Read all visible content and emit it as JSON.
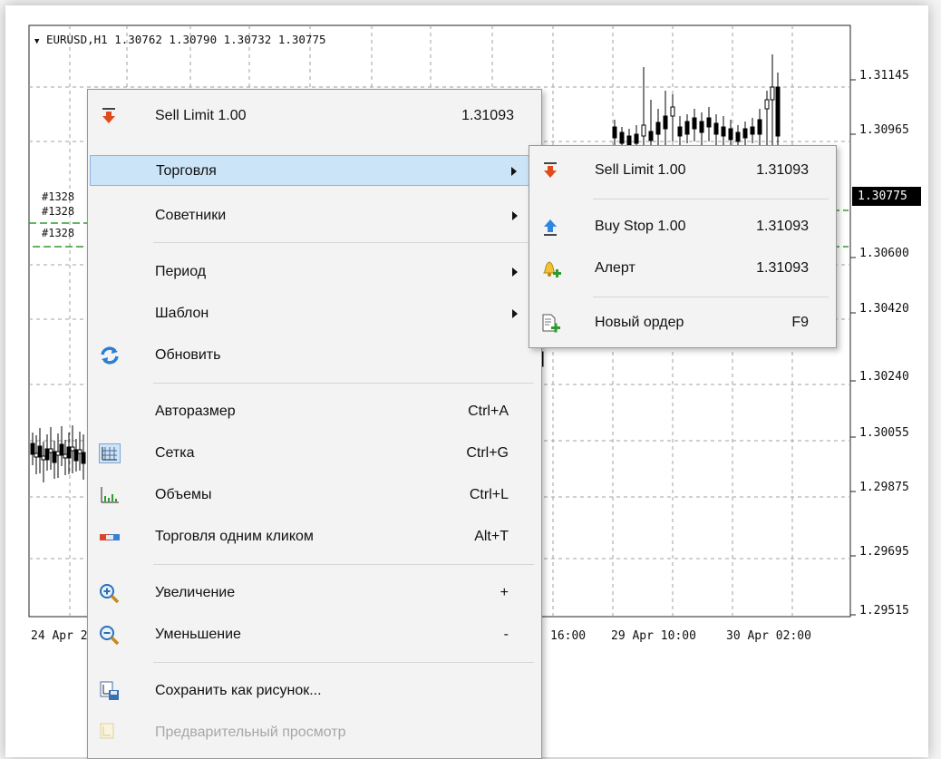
{
  "chart": {
    "ohlc_header": "EURUSD,H1  1.30762 1.30790 1.30732 1.30775",
    "current_price": "1.30775",
    "price_labels": [
      "1.31145",
      "1.30965",
      "1.30600",
      "1.30420",
      "1.30240",
      "1.30055",
      "1.29875",
      "1.29695",
      "1.29515"
    ],
    "time_labels": [
      "24 Apr 2",
      "16:00",
      "29 Apr 10:00",
      "30 Apr 02:00"
    ],
    "order_tags": [
      "#1328",
      "#1328",
      "#1328"
    ],
    "colors": {
      "grid": "#a0a0a0",
      "orders": "#2f9e2f",
      "candles": "#000000"
    }
  },
  "menu": {
    "items": [
      {
        "label": "Sell Limit 1.00",
        "value": "1.31093",
        "icon": "sell-arrow-icon"
      },
      {
        "label": "Торговля",
        "submenu": true,
        "highlight": true
      },
      {
        "label": "Советники",
        "submenu": true
      },
      {
        "label": "Период",
        "submenu": true
      },
      {
        "label": "Шаблон",
        "submenu": true
      },
      {
        "label": "Обновить",
        "icon": "refresh-icon"
      },
      {
        "label": "Авторазмер",
        "shortcut": "Ctrl+A"
      },
      {
        "label": "Сетка",
        "shortcut": "Ctrl+G",
        "icon": "grid-icon"
      },
      {
        "label": "Объемы",
        "shortcut": "Ctrl+L",
        "icon": "volumes-icon"
      },
      {
        "label": "Торговля одним кликом",
        "shortcut": "Alt+T",
        "icon": "one-click-trading-icon"
      },
      {
        "label": "Увеличение",
        "shortcut": "+",
        "icon": "zoom-in-icon"
      },
      {
        "label": "Уменьшение",
        "shortcut": "-",
        "icon": "zoom-out-icon"
      },
      {
        "label": "Сохранить как рисунок...",
        "icon": "save-picture-icon"
      },
      {
        "label": "Предварительный просмотр",
        "icon": "print-preview-icon",
        "disabled": true
      }
    ]
  },
  "submenu": {
    "items": [
      {
        "label": "Sell Limit 1.00",
        "value": "1.31093",
        "icon": "sell-arrow-icon"
      },
      {
        "label": "Buy Stop 1.00",
        "value": "1.31093",
        "icon": "buy-arrow-icon"
      },
      {
        "label": "Алерт",
        "value": "1.31093",
        "icon": "alert-bell-icon"
      },
      {
        "label": "Новый ордер",
        "value": "F9",
        "icon": "new-order-icon"
      }
    ]
  }
}
